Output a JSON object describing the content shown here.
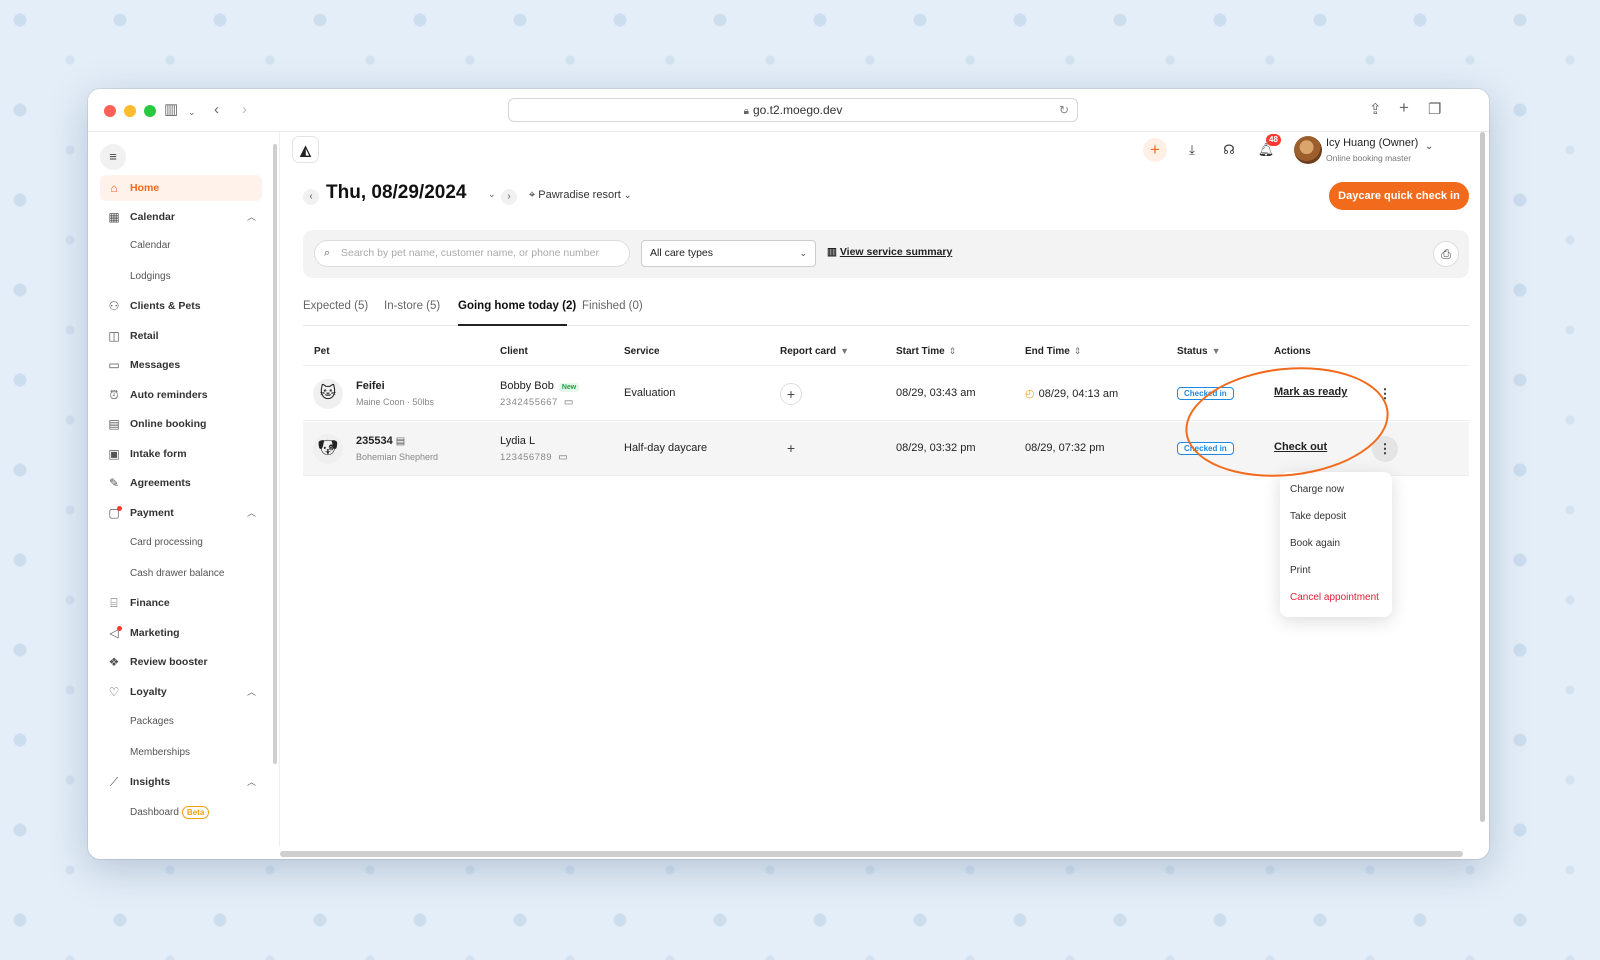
{
  "browser": {
    "url": "go.t2.moego.dev"
  },
  "sidebar": {
    "items": [
      {
        "label": "Home",
        "icon": "home-icon"
      },
      {
        "label": "Calendar",
        "icon": "calendar-icon"
      },
      {
        "label": "Calendar",
        "sub": true
      },
      {
        "label": "Lodgings",
        "sub": true
      },
      {
        "label": "Clients & Pets",
        "icon": "users-icon"
      },
      {
        "label": "Retail",
        "icon": "bag-icon"
      },
      {
        "label": "Messages",
        "icon": "message-icon"
      },
      {
        "label": "Auto reminders",
        "icon": "alarm-icon"
      },
      {
        "label": "Online booking",
        "icon": "booking-icon"
      },
      {
        "label": "Intake form",
        "icon": "form-icon"
      },
      {
        "label": "Agreements",
        "icon": "pen-icon"
      },
      {
        "label": "Payment",
        "icon": "payment-icon"
      },
      {
        "label": "Card processing",
        "sub": true
      },
      {
        "label": "Cash drawer balance",
        "sub": true
      },
      {
        "label": "Finance",
        "icon": "bank-icon"
      },
      {
        "label": "Marketing",
        "icon": "megaphone-icon"
      },
      {
        "label": "Review booster",
        "icon": "review-icon"
      },
      {
        "label": "Loyalty",
        "icon": "loyalty-icon"
      },
      {
        "label": "Packages",
        "sub": true
      },
      {
        "label": "Memberships",
        "sub": true
      },
      {
        "label": "Insights",
        "icon": "chart-icon"
      },
      {
        "label": "Dashboard",
        "sub": true
      }
    ],
    "beta_label": "Beta"
  },
  "header": {
    "notification_count": "48",
    "user_name": "Icy Huang (Owner)",
    "user_role": "Online booking master"
  },
  "toolbar": {
    "date": "Thu, 08/29/2024",
    "location": "Pawradise resort",
    "quick_checkin": "Daycare quick check in"
  },
  "filters": {
    "search_placeholder": "Search by pet name, customer name, or phone number",
    "care_type": "All care types",
    "service_summary": "View service summary"
  },
  "tabs": [
    {
      "label": "Expected (5)"
    },
    {
      "label": "In-store (5)"
    },
    {
      "label": "Going home today (2)",
      "active": true
    },
    {
      "label": "Finished (0)"
    }
  ],
  "table": {
    "headers": {
      "pet": "Pet",
      "client": "Client",
      "service": "Service",
      "report": "Report card",
      "start": "Start Time",
      "end": "End Time",
      "status": "Status",
      "actions": "Actions"
    },
    "rows": [
      {
        "pet_name": "Feifei",
        "pet_breed": "Maine Coon · 50lbs",
        "client": "Bobby Bob",
        "client_tag": "New",
        "phone": "2342455667",
        "service": "Evaluation",
        "start": "08/29, 03:43 am",
        "end": "08/29, 04:13 am",
        "status": "Checked in",
        "action": "Mark as ready"
      },
      {
        "pet_name": "235534",
        "pet_breed": "Bohemian Shepherd",
        "client": "Lydia L",
        "phone": "123456789",
        "service": "Half-day daycare",
        "start": "08/29, 03:32 pm",
        "end": "08/29, 07:32 pm",
        "status": "Checked in",
        "action": "Check out"
      }
    ]
  },
  "dropdown": {
    "items": [
      "Charge now",
      "Take deposit",
      "Book again",
      "Print",
      "Cancel appointment"
    ]
  },
  "colors": {
    "accent": "#f26a1b",
    "status": "#1e88e5",
    "danger": "#e01e37"
  }
}
